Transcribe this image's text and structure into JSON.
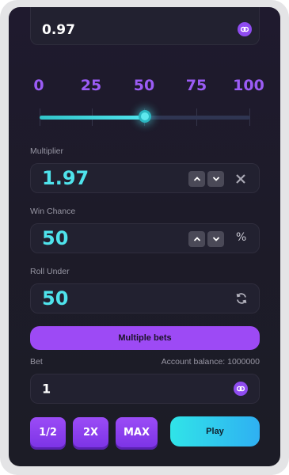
{
  "payout": {
    "value": "0.97",
    "icon": "currency-coin-icon"
  },
  "slider": {
    "marks": [
      "0",
      "25",
      "50",
      "75",
      "100"
    ],
    "value_percent": 50
  },
  "multiplier": {
    "label": "Multiplier",
    "value": "1.97"
  },
  "win_chance": {
    "label": "Win Chance",
    "value": "50",
    "unit": "%"
  },
  "roll_under": {
    "label": "Roll Under",
    "value": "50"
  },
  "multiple_bets_label": "Multiple bets",
  "bet": {
    "label": "Bet",
    "account_balance": "Account balance: 1000000",
    "value": "1"
  },
  "quick_buttons": {
    "half": "1/2",
    "double": "2X",
    "max": "MAX"
  },
  "play_label": "Play",
  "colors": {
    "accent_purple": "#9b5cf5",
    "accent_cyan": "#4fe3ec",
    "panel_bg": "#1d1b29"
  }
}
